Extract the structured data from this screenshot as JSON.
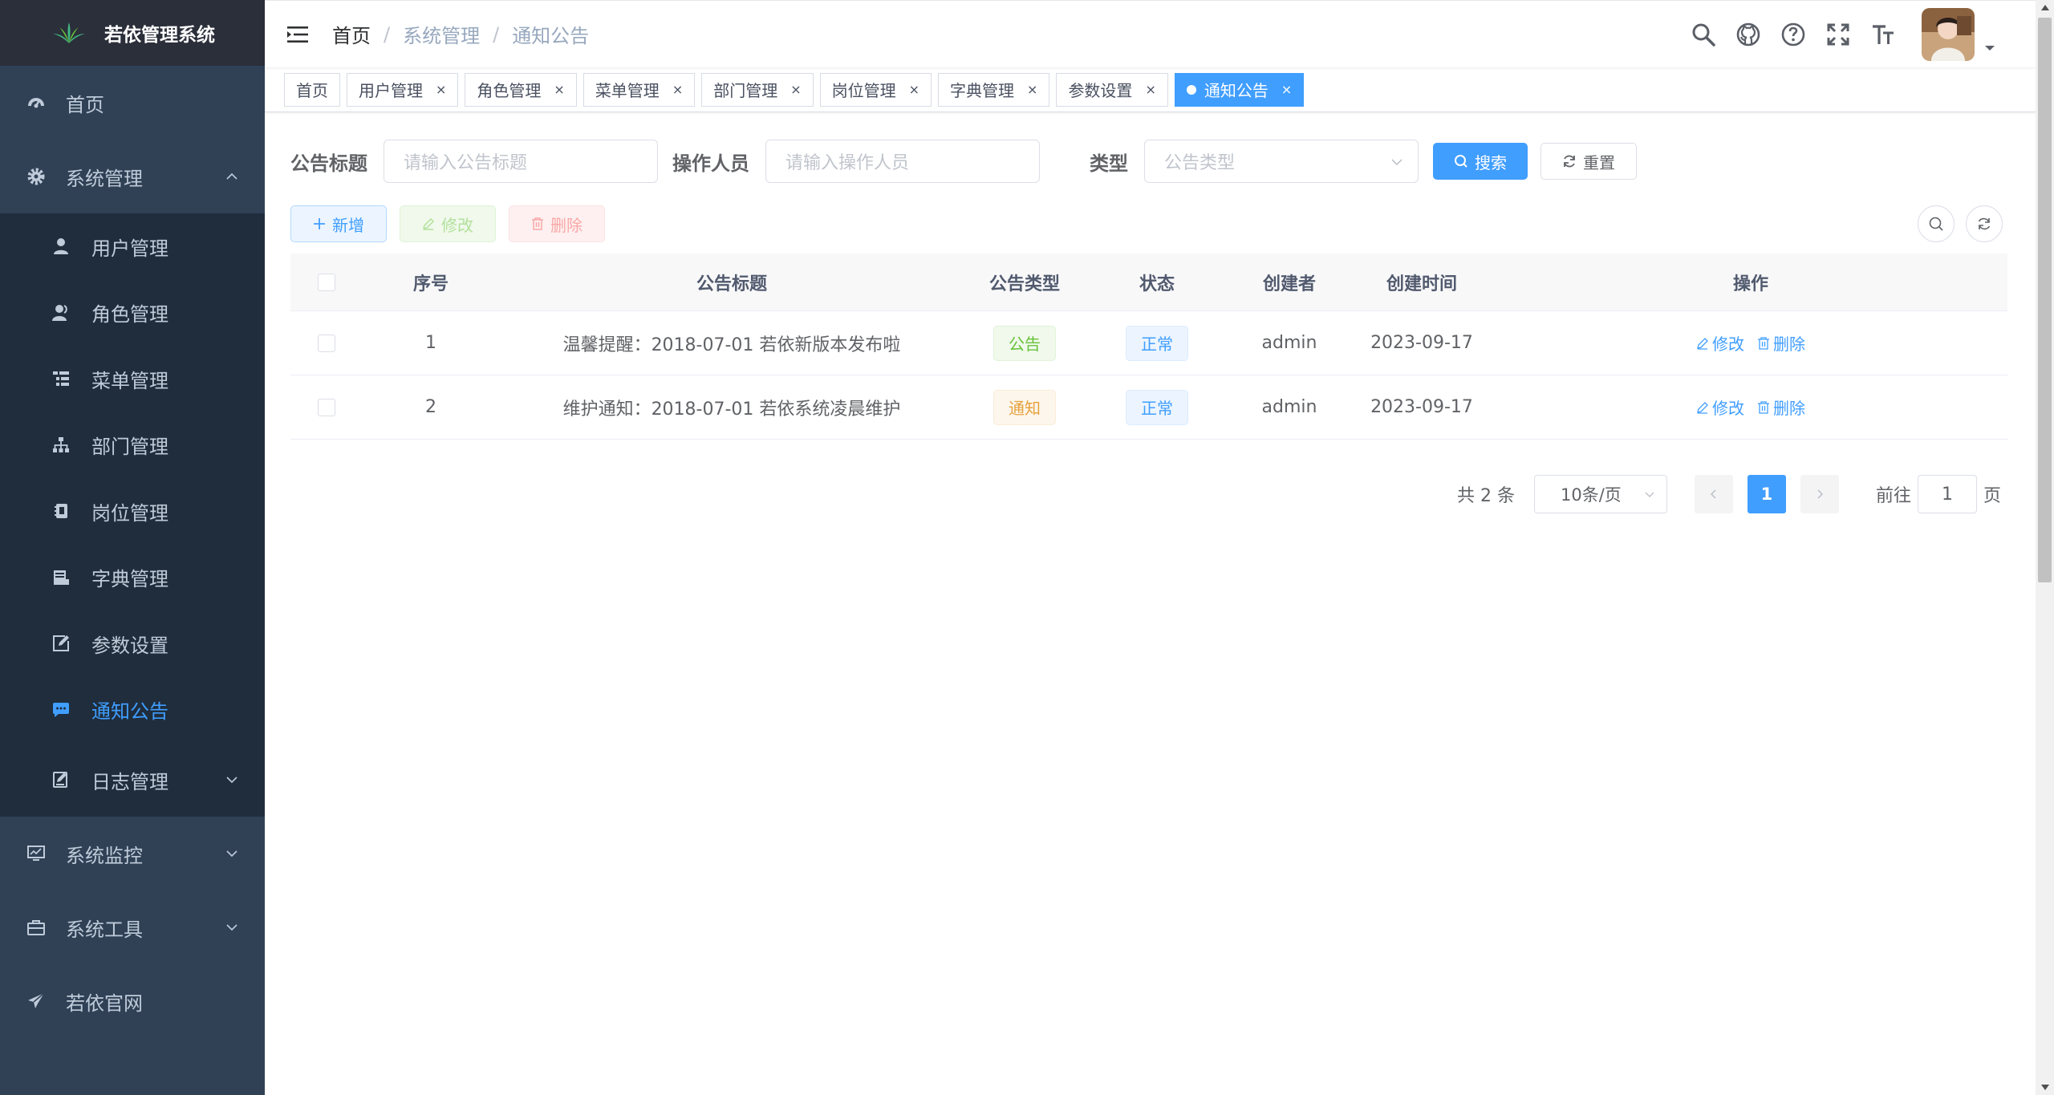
{
  "app": {
    "title": "若依管理系统"
  },
  "colors": {
    "sidebar_bg": "#304156",
    "sidebar_sub_bg": "#1f2d3d",
    "primary": "#409eff",
    "sidebar_text": "#bfcbd9"
  },
  "sidebar": {
    "items": [
      {
        "label": "首页",
        "icon": "dashboard-icon"
      },
      {
        "label": "系统管理",
        "icon": "gear-icon",
        "expanded": true
      },
      {
        "label": "系统监控",
        "icon": "monitor-icon"
      },
      {
        "label": "系统工具",
        "icon": "toolbox-icon"
      },
      {
        "label": "若依官网",
        "icon": "paper-plane-icon"
      }
    ],
    "system_sub": [
      {
        "label": "用户管理",
        "icon": "user-icon"
      },
      {
        "label": "角色管理",
        "icon": "users-icon"
      },
      {
        "label": "菜单管理",
        "icon": "tree-table-icon"
      },
      {
        "label": "部门管理",
        "icon": "org-tree-icon"
      },
      {
        "label": "岗位管理",
        "icon": "badge-icon"
      },
      {
        "label": "字典管理",
        "icon": "dict-icon"
      },
      {
        "label": "参数设置",
        "icon": "edit-icon"
      },
      {
        "label": "通知公告",
        "icon": "message-icon",
        "active": true
      },
      {
        "label": "日志管理",
        "icon": "log-icon"
      }
    ]
  },
  "breadcrumb": [
    "首页",
    "系统管理",
    "通知公告"
  ],
  "tags": [
    {
      "label": "首页"
    },
    {
      "label": "用户管理"
    },
    {
      "label": "角色管理"
    },
    {
      "label": "菜单管理"
    },
    {
      "label": "部门管理"
    },
    {
      "label": "岗位管理"
    },
    {
      "label": "字典管理"
    },
    {
      "label": "参数设置"
    },
    {
      "label": "通知公告",
      "active": true
    }
  ],
  "tag_close": "×",
  "search": {
    "title_label": "公告标题",
    "title_placeholder": "请输入公告标题",
    "operator_label": "操作人员",
    "operator_placeholder": "请输入操作人员",
    "type_label": "类型",
    "type_placeholder": "公告类型",
    "search_btn": "搜索",
    "reset_btn": "重置"
  },
  "toolbar": {
    "add": "新增",
    "edit": "修改",
    "delete": "删除"
  },
  "table": {
    "columns": [
      "序号",
      "公告标题",
      "公告类型",
      "状态",
      "创建者",
      "创建时间",
      "操作"
    ],
    "rows": [
      {
        "id": "1",
        "title": "温馨提醒：2018-07-01 若依新版本发布啦",
        "type": "公告",
        "status": "正常",
        "creator": "admin",
        "time": "2023-09-17"
      },
      {
        "id": "2",
        "title": "维护通知：2018-07-01 若依系统凌晨维护",
        "type": "通知",
        "status": "正常",
        "creator": "admin",
        "time": "2023-09-17"
      }
    ],
    "op_edit": "修改",
    "op_delete": "删除"
  },
  "pagination": {
    "total": "共 2 条",
    "page_size": "10条/页",
    "current": "1",
    "goto_label": "前往",
    "goto_value": "1",
    "page_suffix": "页"
  }
}
